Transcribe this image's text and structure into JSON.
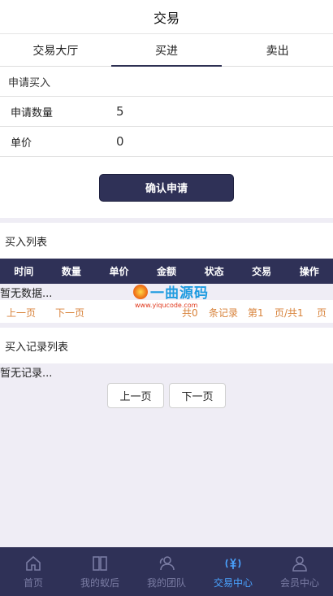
{
  "header": {
    "title": "交易"
  },
  "tabs": [
    {
      "label": "交易大厅",
      "active": false
    },
    {
      "label": "买进",
      "active": true
    },
    {
      "label": "卖出",
      "active": false
    }
  ],
  "form": {
    "header": "申请买入",
    "quantity_label": "申请数量",
    "quantity_value": "5",
    "price_label": "单价",
    "price_value": "0",
    "confirm_label": "确认申请"
  },
  "buy_list": {
    "title": "买入列表",
    "columns": [
      "时间",
      "数量",
      "单价",
      "金额",
      "状态",
      "交易",
      "操作"
    ],
    "empty_text": "暂无数据...",
    "pager": {
      "prev": "上一页",
      "next": "下一页",
      "total_prefix": "共0",
      "records_suffix": "条记录",
      "page_prefix": "第1",
      "page_mid": "页/共1",
      "page_suffix": "页"
    }
  },
  "records": {
    "title": "买入记录列表",
    "empty_text": "暂无记录...",
    "prev_button": "上一页",
    "next_button": "下一页"
  },
  "watermark": {
    "name": "一曲源码",
    "url": "www.yiqucode.com"
  },
  "bottom_nav": [
    {
      "label": "首页",
      "icon": "home-icon",
      "active": false
    },
    {
      "label": "我的蚁后",
      "icon": "book-icon",
      "active": false
    },
    {
      "label": "我的团队",
      "icon": "team-icon",
      "active": false
    },
    {
      "label": "交易中心",
      "icon": "yuan-icon",
      "active": true
    },
    {
      "label": "会员中心",
      "icon": "user-icon",
      "active": false
    }
  ],
  "colors": {
    "primary": "#2f3157",
    "accent_orange": "#d8823a",
    "active_blue": "#4aa3ff"
  }
}
